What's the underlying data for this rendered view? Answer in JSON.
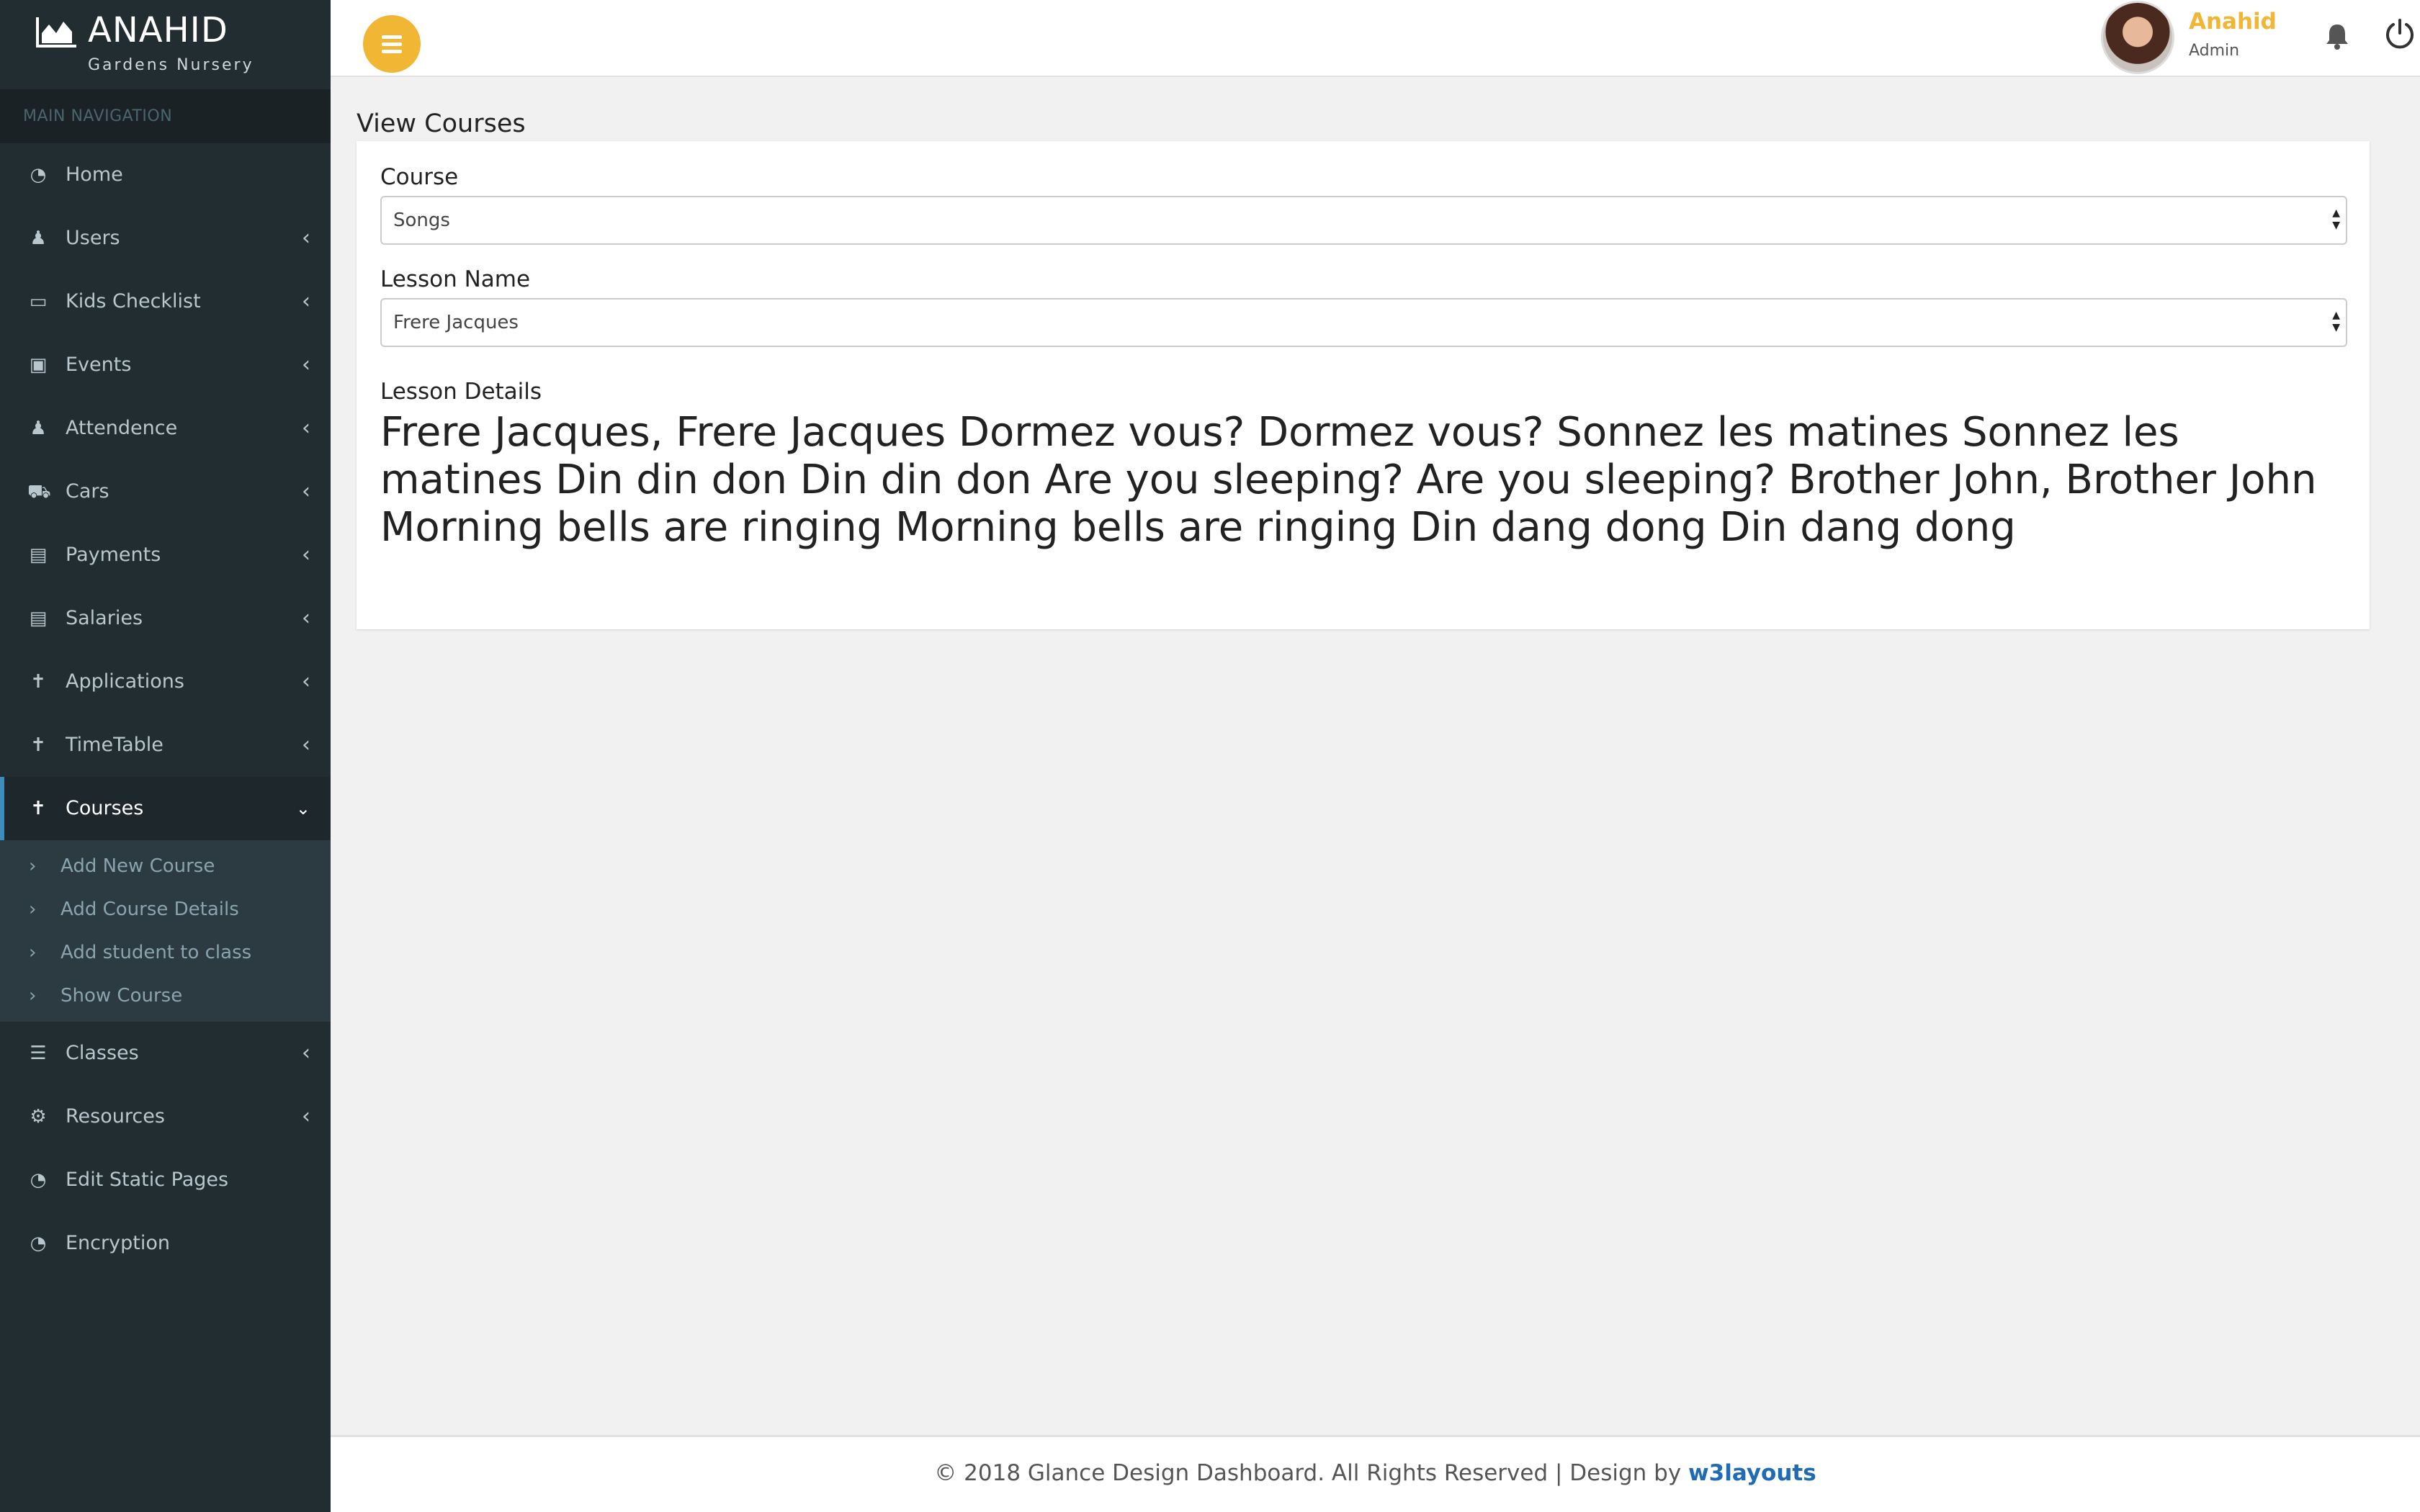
{
  "brand": {
    "title": "ANAHID",
    "subtitle": "Gardens Nursery"
  },
  "sidebar": {
    "header": "MAIN NAVIGATION",
    "items": [
      {
        "label": "Home",
        "icon": "dashboard-icon",
        "has_chevron": false
      },
      {
        "label": "Users",
        "icon": "user-icon",
        "has_chevron": true
      },
      {
        "label": "Kids Checklist",
        "icon": "laptop-icon",
        "has_chevron": true
      },
      {
        "label": "Events",
        "icon": "bus-icon",
        "has_chevron": true
      },
      {
        "label": "Attendence",
        "icon": "user-icon",
        "has_chevron": true
      },
      {
        "label": "Cars",
        "icon": "car-icon",
        "has_chevron": true
      },
      {
        "label": "Payments",
        "icon": "money-icon",
        "has_chevron": true
      },
      {
        "label": "Salaries",
        "icon": "money-icon",
        "has_chevron": true
      },
      {
        "label": "Applications",
        "icon": "child-icon",
        "has_chevron": true
      },
      {
        "label": "TimeTable",
        "icon": "child-icon",
        "has_chevron": true
      },
      {
        "label": "Courses",
        "icon": "child-icon",
        "has_chevron": true,
        "active": true
      },
      {
        "label": "Classes",
        "icon": "list-icon",
        "has_chevron": true
      },
      {
        "label": "Resources",
        "icon": "gear-icon",
        "has_chevron": true
      },
      {
        "label": "Edit Static Pages",
        "icon": "dashboard-icon",
        "has_chevron": false
      },
      {
        "label": "Encryption",
        "icon": "dashboard-icon",
        "has_chevron": false
      }
    ],
    "courses_submenu": [
      "Add New Course",
      "Add Course Details",
      "Add student to class",
      "Show Course"
    ]
  },
  "topbar": {
    "user_name": "Anahid",
    "user_role": "Admin"
  },
  "main": {
    "page_title": "View Courses",
    "course_label": "Course",
    "course_value": "Songs",
    "lesson_label": "Lesson Name",
    "lesson_value": "Frere Jacques",
    "details_label": "Lesson Details",
    "details_text": "Frere Jacques, Frere Jacques Dormez vous? Dormez vous? Sonnez les matines Sonnez les matines Din din don Din din don Are you sleeping? Are you sleeping? Brother John, Brother John Morning bells are ringing Morning bells are ringing Din dang dong Din dang dong"
  },
  "footer": {
    "text": "© 2018 Glance Design Dashboard. All Rights Reserved | Design by ",
    "link": "w3layouts"
  },
  "colors": {
    "sidebar_bg": "#222d32",
    "accent": "#f2b635",
    "active_border": "#3c8dbc",
    "link": "#1f6bb5"
  }
}
